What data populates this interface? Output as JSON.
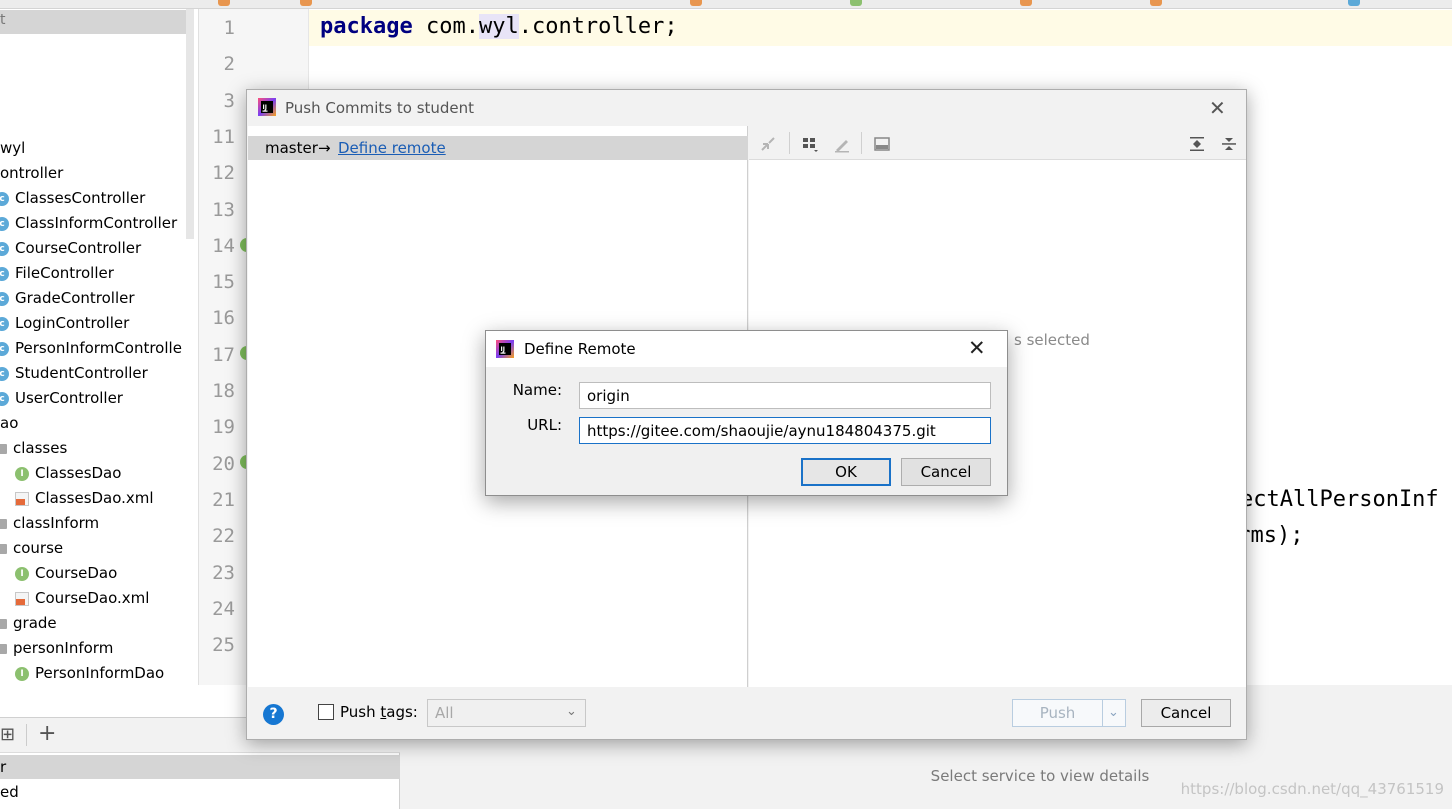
{
  "project_tree": {
    "header_fragment": "t",
    "items": [
      {
        "label": "wyl",
        "icon": "none"
      },
      {
        "label": "ontroller",
        "icon": "none"
      },
      {
        "label": "ClassesController",
        "icon": "class-icon"
      },
      {
        "label": "ClassInformController",
        "icon": "class-icon"
      },
      {
        "label": "CourseController",
        "icon": "class-icon"
      },
      {
        "label": "FileController",
        "icon": "class-icon"
      },
      {
        "label": "GradeController",
        "icon": "class-icon"
      },
      {
        "label": "LoginController",
        "icon": "class-icon"
      },
      {
        "label": "PersonInformControlle",
        "icon": "class-icon"
      },
      {
        "label": "StudentController",
        "icon": "class-icon"
      },
      {
        "label": "UserController",
        "icon": "class-icon"
      },
      {
        "label": "ao",
        "icon": "none"
      },
      {
        "label": "classes",
        "icon": "folder-icon"
      },
      {
        "label": "ClassesDao",
        "icon": "interface-icon"
      },
      {
        "label": "ClassesDao.xml",
        "icon": "xml-file-icon"
      },
      {
        "label": "classInform",
        "icon": "folder-icon"
      },
      {
        "label": "course",
        "icon": "folder-icon"
      },
      {
        "label": "CourseDao",
        "icon": "interface-icon"
      },
      {
        "label": "CourseDao.xml",
        "icon": "xml-file-icon"
      },
      {
        "label": "grade",
        "icon": "folder-icon"
      },
      {
        "label": "personInform",
        "icon": "folder-icon"
      },
      {
        "label": "PersonInformDao",
        "icon": "interface-icon"
      }
    ]
  },
  "editor": {
    "line_numbers": [
      "1",
      "2",
      "3",
      "11",
      "12",
      "13",
      "14",
      "15",
      "16",
      "17",
      "18",
      "19",
      "20",
      "21",
      "22",
      "23",
      "24",
      "25"
    ],
    "code_line1": {
      "keyword": "package",
      "pre": "com.",
      "highlight": "wyl",
      "post": ".controller;"
    },
    "code_fragment_1": "ectAllPersonInf",
    "code_fragment_2": "orms);"
  },
  "bottom_panel": {
    "left_row_1": "r",
    "left_row_2": "ed",
    "details_message": "Select service to view details"
  },
  "push_dialog": {
    "title": "Push Commits to student",
    "branch": "master",
    "arrow": "→",
    "define_remote_link": "Define remote",
    "empty_message": "s selected",
    "push_tags_label_pre": "Push ",
    "push_tags_label_accel": "t",
    "push_tags_label_post": "ags:",
    "tags_value": "All",
    "push_button": "Push",
    "cancel_button": "Cancel"
  },
  "define_remote_dialog": {
    "title": "Define Remote",
    "name_label": "Name:",
    "name_value": "origin",
    "url_label": "URL:",
    "url_value": "https://gitee.com/shaoujie/aynu184804375.git",
    "ok_button": "OK",
    "cancel_button": "Cancel"
  },
  "watermark": "https://blog.csdn.net/qq_43761519",
  "colors": {
    "accent": "#1a72c8",
    "link": "#1a5db5",
    "keyword": "#000080",
    "class_icon": "#5ca9d8",
    "interface_icon": "#8cc06f"
  }
}
